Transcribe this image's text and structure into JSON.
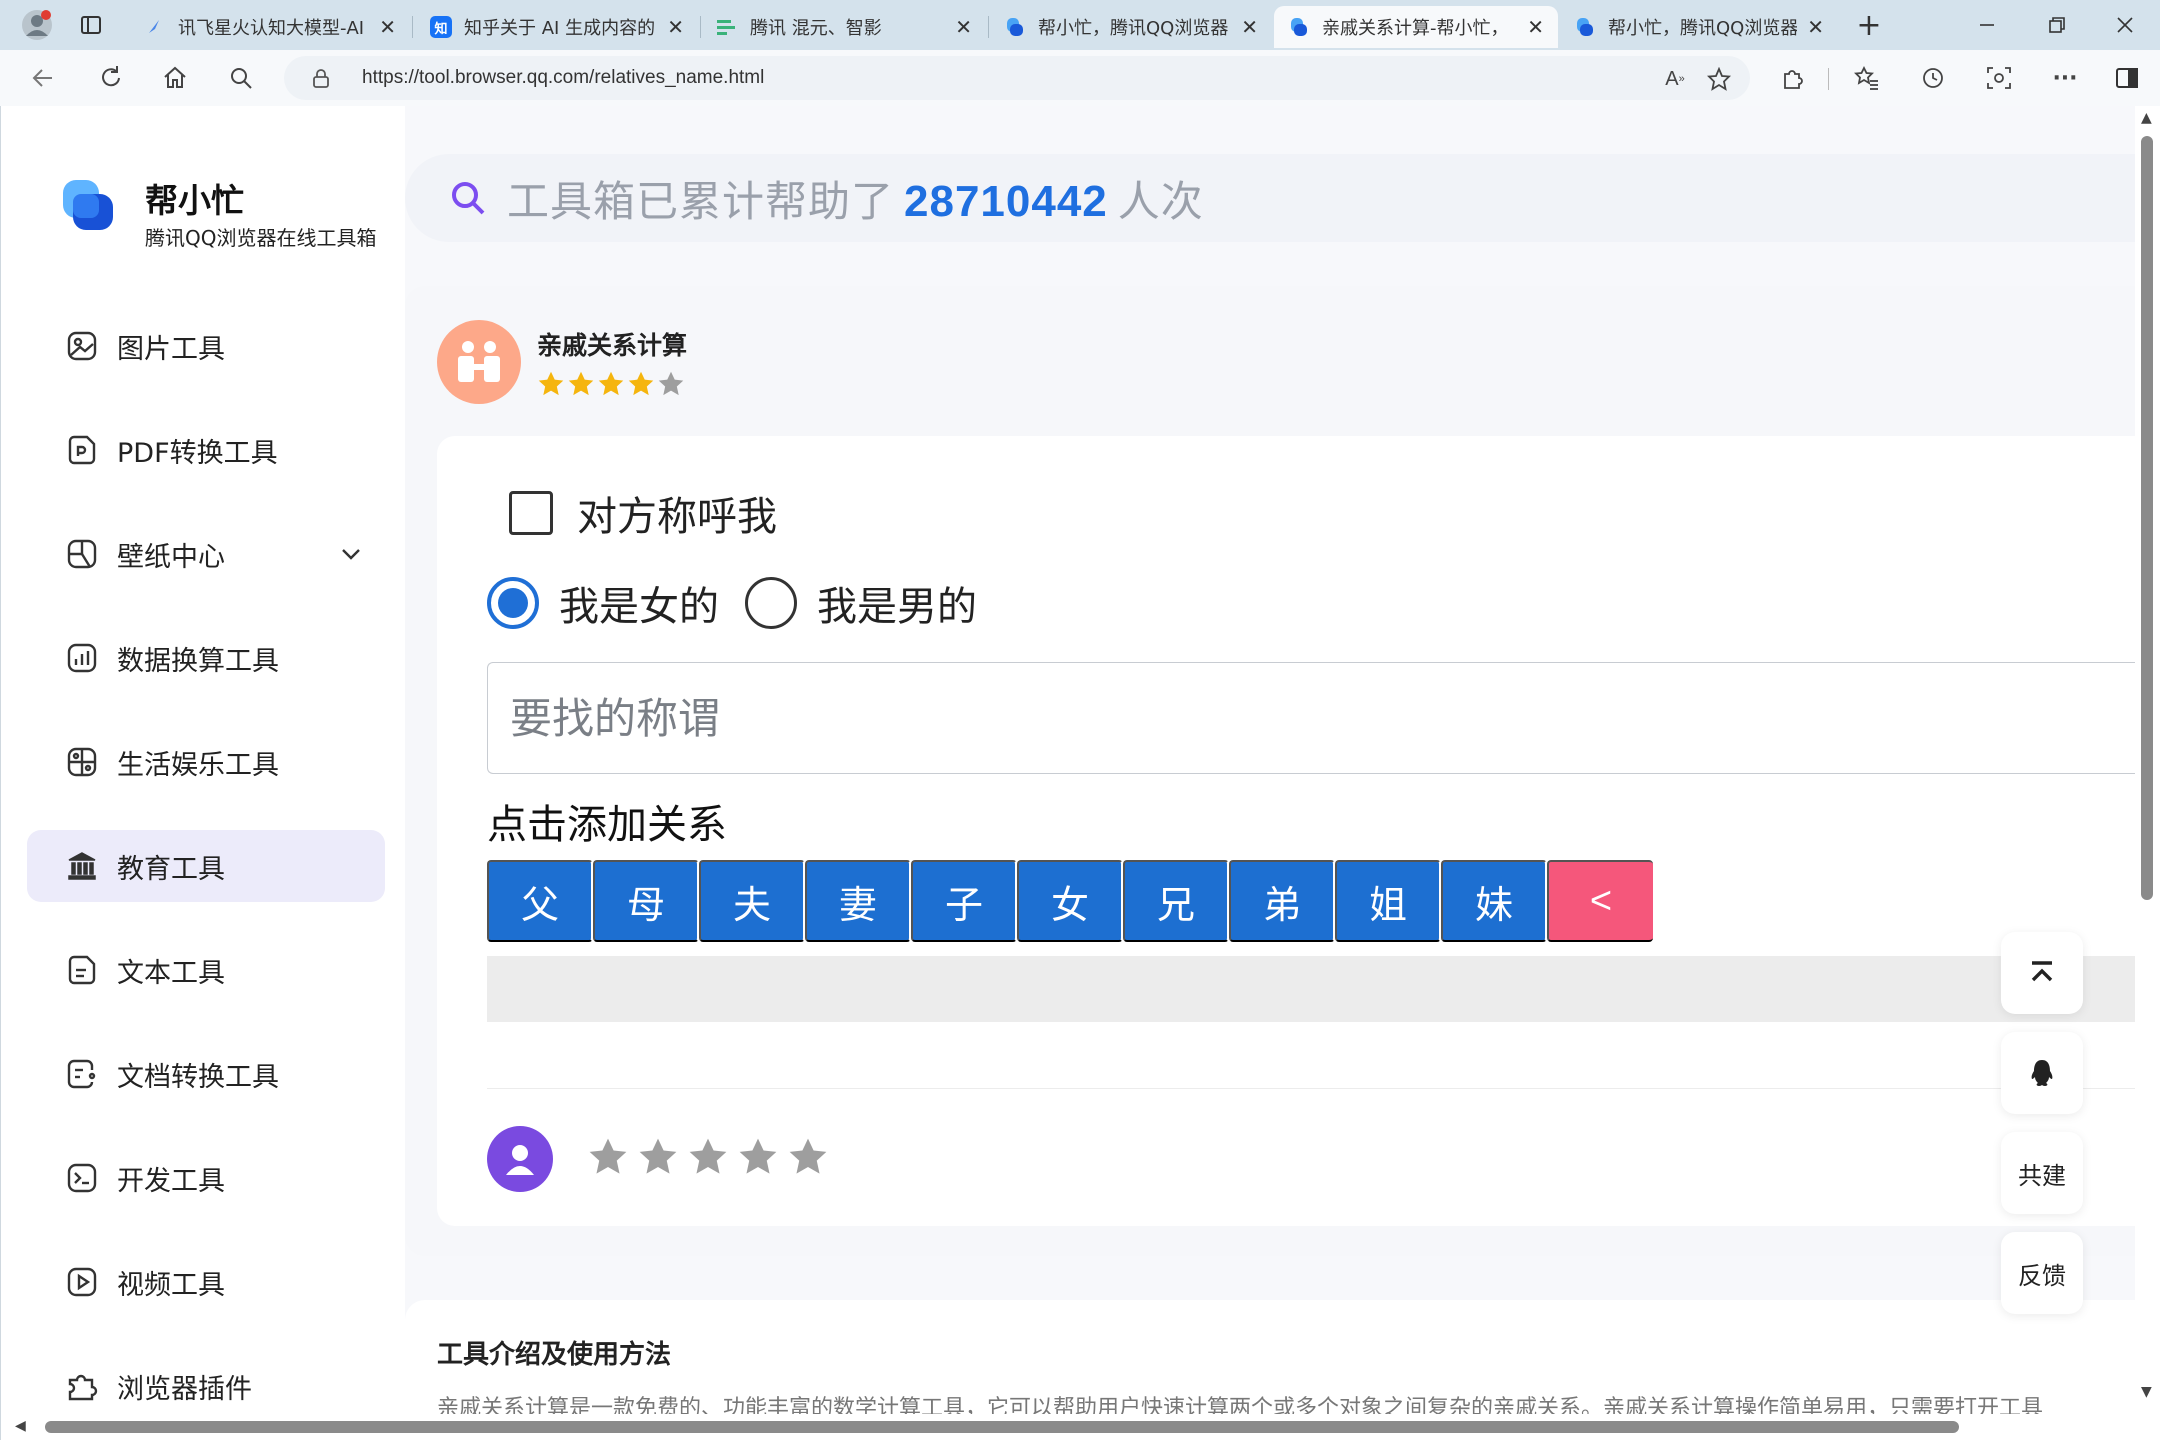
{
  "browser": {
    "tabs": [
      {
        "title": "讯飞星火认知大模型-AI",
        "active": false
      },
      {
        "title": "知乎关于 AI 生成内容的",
        "active": false
      },
      {
        "title": "腾讯 混元、智影",
        "active": false
      },
      {
        "title": "帮小忙，腾讯QQ浏览器",
        "active": false
      },
      {
        "title": "亲戚关系计算-帮小忙，",
        "active": true
      },
      {
        "title": "帮小忙，腾讯QQ浏览器",
        "active": false
      }
    ],
    "url": "https://tool.browser.qq.com/relatives_name.html",
    "zhihu_badge": "知"
  },
  "sidebar": {
    "brand_name": "帮小忙",
    "brand_sub": "腾讯QQ浏览器在线工具箱",
    "items": [
      {
        "label": "图片工具",
        "icon": "image-icon"
      },
      {
        "label": "PDF转换工具",
        "icon": "pdf-icon"
      },
      {
        "label": "壁纸中心",
        "icon": "wallpaper-icon"
      },
      {
        "label": "数据换算工具",
        "icon": "chart-icon"
      },
      {
        "label": "生活娱乐工具",
        "icon": "entertainment-icon"
      },
      {
        "label": "教育工具",
        "icon": "education-icon"
      },
      {
        "label": "文本工具",
        "icon": "text-icon"
      },
      {
        "label": "文档转换工具",
        "icon": "document-icon"
      },
      {
        "label": "开发工具",
        "icon": "terminal-icon"
      },
      {
        "label": "视频工具",
        "icon": "video-icon"
      },
      {
        "label": "浏览器插件",
        "icon": "puzzle-icon"
      }
    ],
    "active_index": 5
  },
  "search": {
    "prefix": "工具箱已累计帮助了",
    "count": "28710442",
    "suffix": "人次"
  },
  "tool": {
    "title": "亲戚关系计算",
    "rating": 4,
    "rating_max": 5,
    "reverse_label": "对方称呼我",
    "reverse_checked": false,
    "gender_female": "我是女的",
    "gender_male": "我是男的",
    "gender_selected": "female",
    "input_placeholder": "要找的称谓",
    "input_value": "",
    "add_label": "点击添加关系",
    "relations": [
      "父",
      "母",
      "夫",
      "妻",
      "子",
      "女",
      "兄",
      "弟",
      "姐",
      "妹"
    ],
    "back_label": "<",
    "user_rating": 0
  },
  "intro": {
    "title": "工具介绍及使用方法",
    "text": "亲戚关系计算是一款免费的、功能丰富的数学计算工具，它可以帮助用户快速计算两个或多个对象之间复杂的亲戚关系。亲戚关系计算操作简单易用，只需要打开工具"
  },
  "floating": {
    "cocreate": "共建",
    "feedback": "反馈"
  },
  "colors": {
    "accent": "#1d6fd1",
    "back_button": "#f5577b",
    "count": "#1f6fe0",
    "star_on": "#f5b50e",
    "star_off": "#9e9e9e",
    "sidebar_active": "#ecebfa"
  }
}
